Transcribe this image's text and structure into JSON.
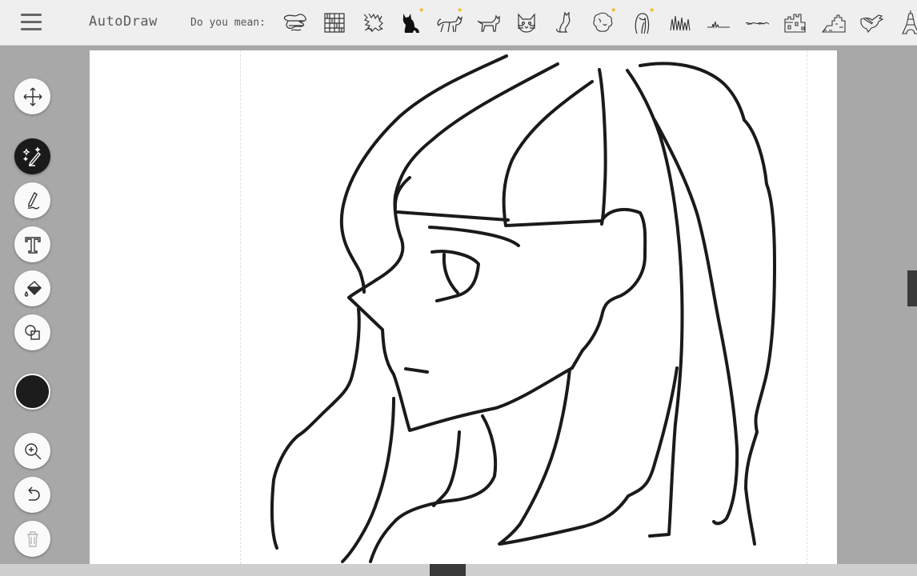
{
  "app": {
    "brand": "AutoDraw",
    "menu_icon": "hamburger-menu-icon"
  },
  "suggestions": {
    "label": "Do you mean:",
    "items": [
      {
        "name": "pattern-scribble-1",
        "starred": false
      },
      {
        "name": "pattern-grid",
        "starred": false
      },
      {
        "name": "pattern-scribble-2",
        "starred": false
      },
      {
        "name": "black-cat",
        "starred": true
      },
      {
        "name": "cat-walking",
        "starred": true
      },
      {
        "name": "cat-standing",
        "starred": false
      },
      {
        "name": "cat-face",
        "starred": false
      },
      {
        "name": "cat-sitting",
        "starred": false
      },
      {
        "name": "poodle",
        "starred": true
      },
      {
        "name": "hair-profile",
        "starred": true
      },
      {
        "name": "grass",
        "starred": false
      },
      {
        "name": "grass-line",
        "starred": false
      },
      {
        "name": "flat-scribble",
        "starred": false
      },
      {
        "name": "castle",
        "starred": false
      },
      {
        "name": "great-wall",
        "starred": false
      },
      {
        "name": "bird",
        "starred": false
      },
      {
        "name": "eiffel-tower",
        "starred": false
      }
    ],
    "star_glyph": "★"
  },
  "tools": [
    {
      "name": "move-tool",
      "icon": "move-arrows-icon",
      "active": false
    },
    {
      "name": "autodraw-tool",
      "icon": "magic-pencil-icon",
      "active": true
    },
    {
      "name": "draw-tool",
      "icon": "pen-icon",
      "active": false
    },
    {
      "name": "type-tool",
      "icon": "text-T-icon",
      "active": false
    },
    {
      "name": "fill-tool",
      "icon": "paint-bucket-icon",
      "active": false
    },
    {
      "name": "shape-tool",
      "icon": "shapes-icon",
      "active": false
    },
    {
      "name": "zoom-tool",
      "icon": "zoom-in-icon",
      "active": false
    },
    {
      "name": "undo-tool",
      "icon": "undo-icon",
      "active": false
    },
    {
      "name": "delete-tool",
      "icon": "trash-icon",
      "active": false
    }
  ],
  "colors": {
    "current": "#1c1c1c",
    "active_tool_bg": "#1a1a1a",
    "star": "#f4b400"
  }
}
